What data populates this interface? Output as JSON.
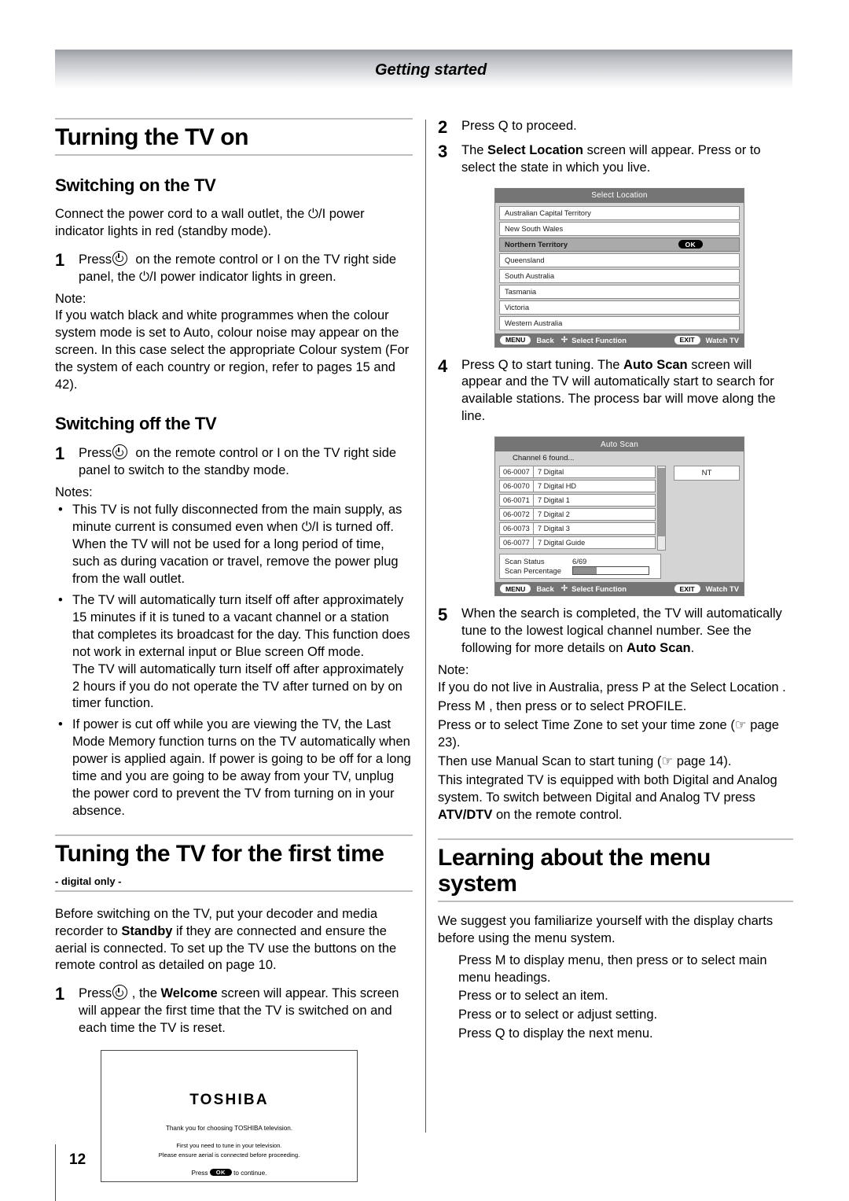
{
  "header": {
    "running_title": "Getting started"
  },
  "footer": {
    "page_number": "12"
  },
  "left_column": {
    "section_title": "Turning the TV on",
    "sub1_title": "Switching on the TV",
    "sub1_intro": "Connect the power cord to a wall outlet, the ⏻/I power indicator lights in red (standby mode).",
    "sub1_step1_num": "1",
    "sub1_step1_text_a": "Press",
    "sub1_step1_text_b": "on the remote control or I on the TV right side panel, the ⏻/I power indicator lights in green.",
    "note_label": "Note:",
    "note_text": "If you watch black and white programmes when the colour system mode is set to Auto, colour noise may appear on the screen. In this case select the appropriate Colour system (For the system of each country or region, refer to pages 15 and 42).",
    "sub2_title": "Switching off the TV",
    "sub2_step1_num": "1",
    "sub2_step1_text_a": "Press",
    "sub2_step1_text_b": "on the remote control or I on the TV right side panel to switch to the standby mode.",
    "notes_label": "Notes:",
    "notes": [
      "This TV is not fully disconnected from the main supply, as minute current is consumed even when ⏻/I is turned off. When the TV will not be used for a long period of time, such as during vacation or travel, remove the power plug from the wall outlet.",
      "The TV will automatically turn itself off after approximately 15 minutes if it is tuned to a vacant channel or a station that completes its broadcast for the day. This function does not work in external input or Blue screen Off mode.\nThe TV will automatically turn itself off after approximately 2 hours if you do not operate the TV after turned on by on timer function.",
      "If power is cut off while you are viewing the TV, the Last Mode Memory function turns on the TV automatically when power is applied again. If power is going to be off for a long time and you are going to be away from your TV, unplug the power cord to prevent the TV from turning on in your absence."
    ],
    "section2_title": "Tuning the TV for the first time",
    "section2_subtitle": "- digital only -",
    "section2_intro_a": "Before switching on the TV, put your decoder and media recorder to ",
    "section2_intro_bold": "Standby",
    "section2_intro_b": " if they are connected and ensure the aerial is connected. To set up the TV use the buttons on the remote control as detailed on page 10.",
    "section2_step1_num": "1",
    "section2_step1_a": "Press",
    "section2_step1_b": ", the ",
    "section2_step1_bold": "Welcome",
    "section2_step1_c": " screen will appear. This screen will appear the first time that the TV is switched on and each time the TV is reset.",
    "welcome_screen": {
      "logo": "TOSHIBA",
      "line1": "Thank you for choosing TOSHIBA television.",
      "line2a": "First you need to tune in your television.",
      "line2b": "Please ensure aerial is connected before proceeding.",
      "line3_pre": "Press",
      "line3_key": "OK",
      "line3_post": "to continue."
    }
  },
  "right_column": {
    "step2_num": "2",
    "step2_text": "Press Q to proceed.",
    "step3_num": "3",
    "step3_a": "The ",
    "step3_bold": "Select Location",
    "step3_b": " screen will appear. Press  or  to select the state in which you live.",
    "select_location_screen": {
      "title": "Select Location",
      "items": [
        {
          "label": "Australian Capital Territory",
          "selected": false
        },
        {
          "label": "New South Wales",
          "selected": false
        },
        {
          "label": "Northern Territory",
          "selected": true,
          "badge": "OK"
        },
        {
          "label": "Queensland",
          "selected": false
        },
        {
          "label": "South Australia",
          "selected": false
        },
        {
          "label": "Tasmania",
          "selected": false
        },
        {
          "label": "Victoria",
          "selected": false
        },
        {
          "label": "Western Australia",
          "selected": false
        }
      ],
      "footer_menu_key": "MENU",
      "footer_menu_label": "Back",
      "footer_select_label": "Select Function",
      "footer_exit_key": "EXIT",
      "footer_exit_label": "Watch TV"
    },
    "step4_num": "4",
    "step4_a": "Press Q to start tuning. The ",
    "step4_bold": "Auto Scan",
    "step4_b": " screen will appear and the TV will automatically start to search for available stations. The process bar will move along the line.",
    "auto_scan_screen": {
      "title": "Auto Scan",
      "found_text": "Channel 6 found...",
      "region": "NT",
      "channels": [
        {
          "number": "06-0007",
          "name": "7 Digital"
        },
        {
          "number": "06-0070",
          "name": "7 Digital HD"
        },
        {
          "number": "06-0071",
          "name": "7 Digital 1"
        },
        {
          "number": "06-0072",
          "name": "7 Digital 2"
        },
        {
          "number": "06-0073",
          "name": "7 Digital 3"
        },
        {
          "number": "06-0077",
          "name": "7 Digital Guide"
        }
      ],
      "scan_status_label": "Scan Status",
      "scan_status_value": "6/69",
      "scan_percentage_label": "Scan Percentage",
      "scan_percentage_value": 31,
      "footer_menu_key": "MENU",
      "footer_menu_label": "Back",
      "footer_select_label": "Select Function",
      "footer_exit_key": "EXIT",
      "footer_exit_label": "Watch TV"
    },
    "step5_num": "5",
    "step5_a": "When the search is completed, the TV will automatically tune to the lowest logical channel number. See the following for more details on ",
    "step5_bold": "Auto Scan",
    "step5_b": ".",
    "note_label": "Note:",
    "note_line1": "If you do not live in Australia, press P at the Select Location .",
    "note_line2": "Press M , then press  or  to select PROFILE.",
    "note_line3": "Press  or  to select Time Zone to set your time zone (☞ page 23).",
    "note_line4": "Then use Manual Scan to start tuning (☞ page 14).",
    "note_line5_a": "This integrated TV is equipped with both Digital and Analog system. To switch between Digital and Analog TV press ",
    "note_line5_bold": "ATV/DTV",
    "note_line5_b": " on the remote control.",
    "menu_section_title": "Learning about the menu system",
    "menu_intro": "We suggest you familiarize yourself with the display charts before using the menu system.",
    "menu_steps": [
      "Press M to display menu, then press  or  to select main menu headings.",
      "Press  or  to select an item.",
      "Press  or  to select or adjust setting.",
      "Press Q to display the next menu."
    ]
  }
}
